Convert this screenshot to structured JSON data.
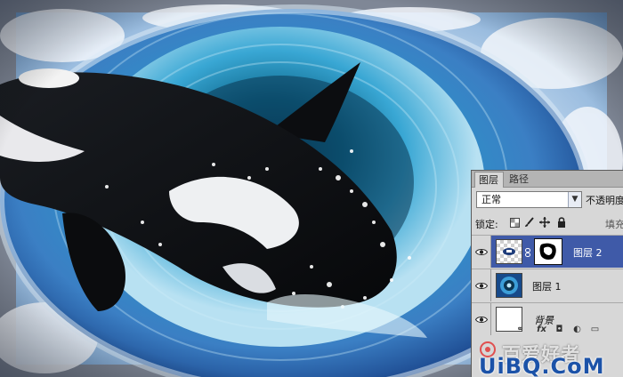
{
  "panel": {
    "tabs": [
      {
        "label": "图层",
        "active": true
      },
      {
        "label": "路径",
        "active": false
      }
    ],
    "blend_mode": "正常",
    "opacity_label": "不透明度",
    "lock_label": "锁定:",
    "fill_label": "填充",
    "layers": [
      {
        "name": "图层 2",
        "selected": true,
        "visible": true,
        "has_mask": true
      },
      {
        "name": "图层 1",
        "selected": false,
        "visible": true,
        "has_mask": false
      },
      {
        "name": "背景",
        "selected": false,
        "visible": true,
        "has_mask": false,
        "italic": true
      }
    ],
    "footer_icons": [
      "link-icon",
      "fx-icon",
      "mask-icon",
      "adjustment-icon",
      "group-icon"
    ]
  },
  "watermark": {
    "chinese": "百爱好者",
    "domain": "UiBQ.CoM"
  },
  "colors": {
    "selected_row": "#3f5aa8",
    "panel_bg": "#d7d7d7",
    "watermark_blue": "#1b52a8"
  }
}
